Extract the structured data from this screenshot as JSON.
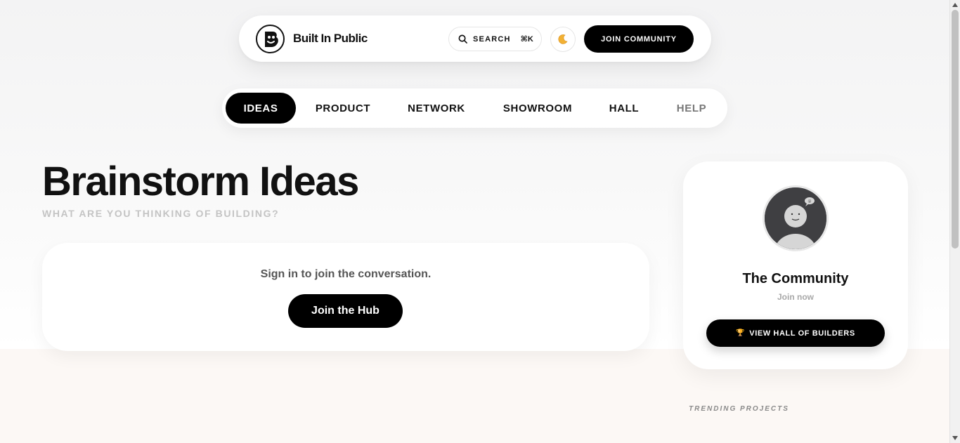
{
  "header": {
    "brand": "Built In Public",
    "search_label": "SEARCH",
    "search_shortcut": "⌘K",
    "theme_icon": "moon-icon",
    "join_label": "JOIN COMMUNITY"
  },
  "nav": {
    "tabs": [
      {
        "label": "IDEAS",
        "active": true
      },
      {
        "label": "PRODUCT"
      },
      {
        "label": "NETWORK"
      },
      {
        "label": "SHOWROOM"
      },
      {
        "label": "HALL"
      },
      {
        "label": "HELP"
      }
    ]
  },
  "main": {
    "title": "Brainstorm Ideas",
    "subtitle": "WHAT ARE YOU THINKING OF BUILDING?",
    "signin_text": "Sign in to join the conversation.",
    "hub_button": "Join the Hub"
  },
  "sidebar": {
    "community_name": "The Community",
    "community_sub": "Join now",
    "hall_button": "VIEW HALL OF BUILDERS",
    "hall_icon": "🏆",
    "trending_label": "TRENDING PROJECTS"
  },
  "colors": {
    "accent": "#000000",
    "background": "#f3f3f4",
    "lower_background": "#fcf8f5"
  }
}
